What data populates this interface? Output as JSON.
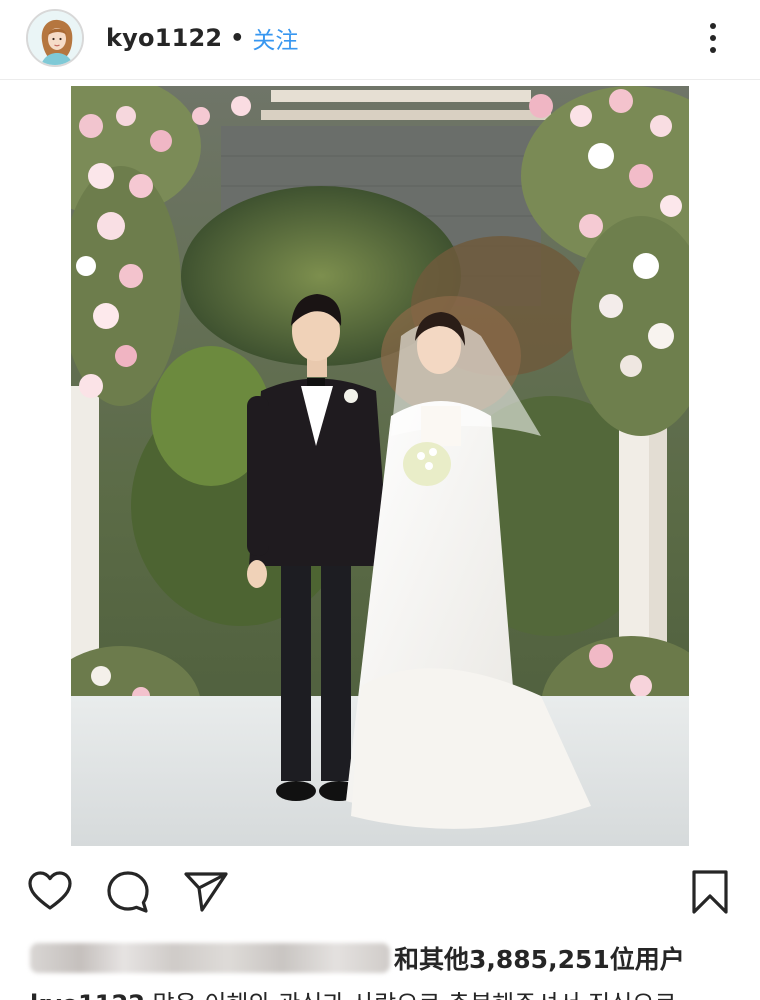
{
  "post": {
    "username": "kyo1122",
    "separator": "•",
    "follow_label": "关注",
    "likes_text": "和其他3,885,251位用户",
    "caption_user": "kyo1122",
    "caption_text": "많은 이해와 관심과 사랑으로 축복해주셔서 진심으로"
  },
  "icons": {
    "avatar": "avatar-illustration",
    "more": "more-vertical-icon",
    "like": "heart-icon",
    "comment": "comment-bubble-icon",
    "share": "paper-plane-icon",
    "save": "bookmark-icon"
  },
  "colors": {
    "accent": "#3897f0",
    "text": "#262626"
  }
}
